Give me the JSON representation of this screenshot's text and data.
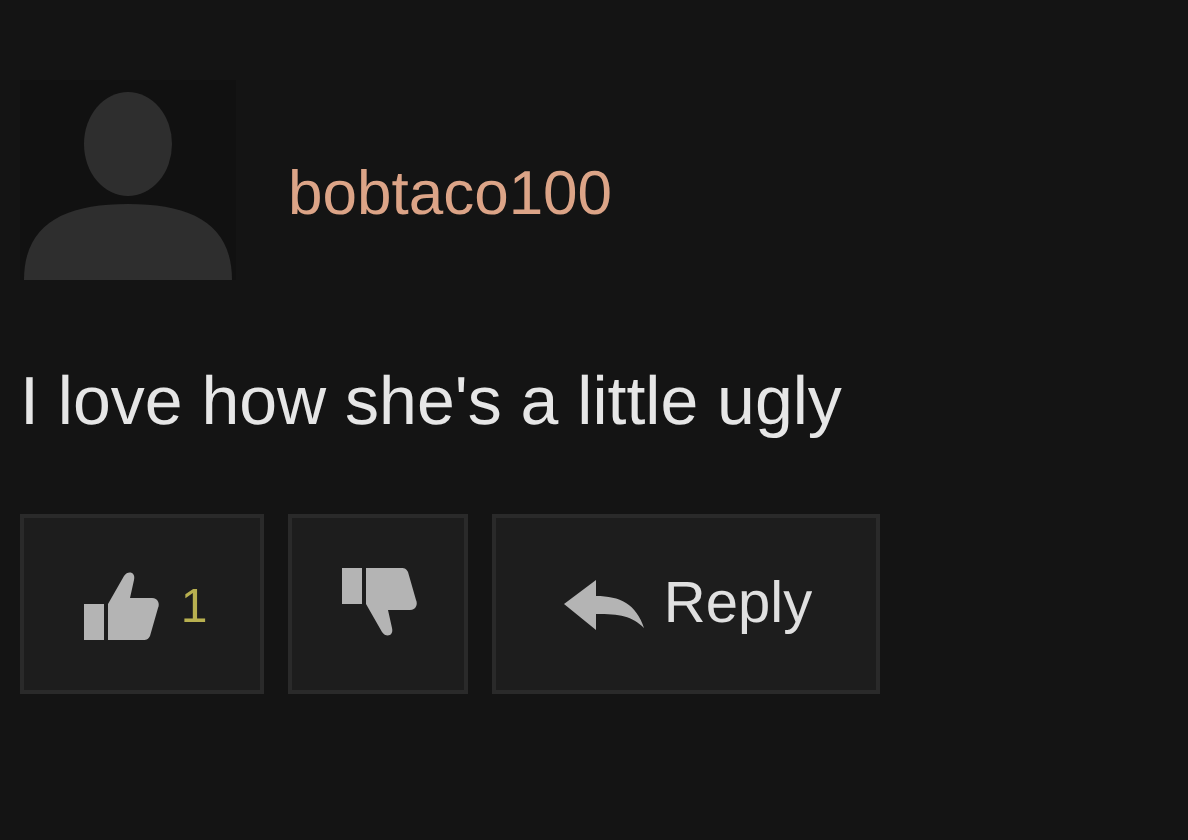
{
  "comment": {
    "username": "bobtaco100",
    "text": "I love how she's a little ugly"
  },
  "actions": [
    {
      "kind": "like",
      "count": "1"
    },
    {
      "kind": "dislike"
    },
    {
      "kind": "reply",
      "label": "Reply"
    }
  ]
}
